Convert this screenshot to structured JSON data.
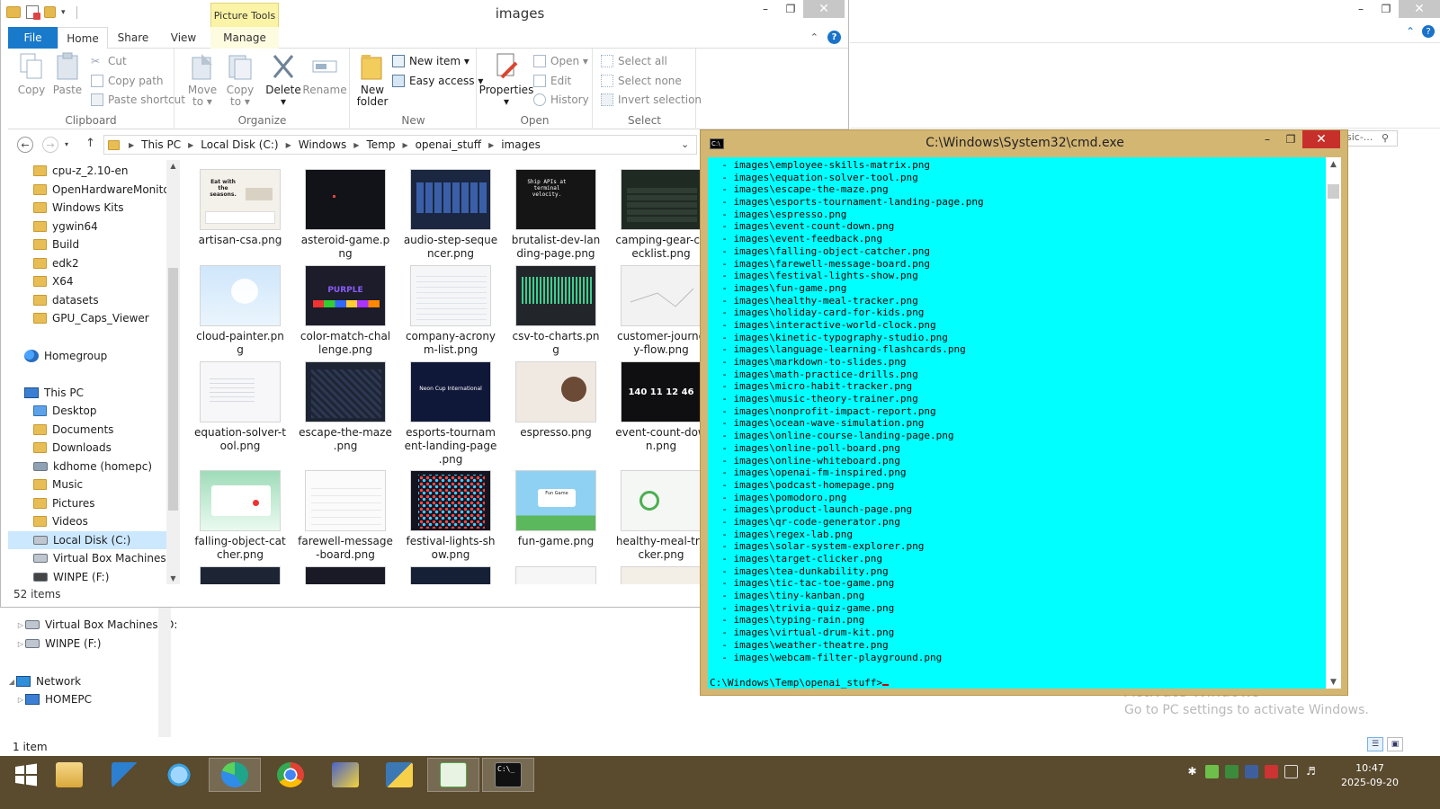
{
  "background_window": {
    "search_placeholder": "sic-...",
    "tree": [
      {
        "label": "Virtual Box Machines (D:",
        "icon": "drive-icon"
      },
      {
        "label": "WINPE (F:)",
        "icon": "drive-icon"
      },
      {
        "label": "Network",
        "icon": "network-icon"
      },
      {
        "label": "HOMEPC",
        "icon": "pc-icon"
      }
    ],
    "status": "1 item",
    "activate_title": "Activate Windows",
    "activate_sub": "Go to PC settings to activate Windows."
  },
  "window": {
    "title": "images",
    "picture_tools": "Picture Tools",
    "tabs": {
      "file": "File",
      "home": "Home",
      "share": "Share",
      "view": "View",
      "manage": "Manage"
    }
  },
  "ribbon": {
    "clipboard": {
      "label": "Clipboard",
      "copy": "Copy",
      "paste": "Paste",
      "cut": "Cut",
      "copy_path": "Copy path",
      "paste_shortcut": "Paste shortcut"
    },
    "organize": {
      "label": "Organize",
      "move_to_1": "Move",
      "move_to_2": "to ▾",
      "copy_to_1": "Copy",
      "copy_to_2": "to ▾",
      "delete": "Delete",
      "delete_arrow": "▾",
      "rename": "Rename"
    },
    "new": {
      "label": "New",
      "new_folder_1": "New",
      "new_folder_2": "folder",
      "new_item": "New item ▾",
      "easy_access": "Easy access ▾"
    },
    "open": {
      "label": "Open",
      "properties": "Properties",
      "properties_arrow": "▾",
      "open": "Open ▾",
      "edit": "Edit",
      "history": "History"
    },
    "select": {
      "label": "Select",
      "select_all": "Select all",
      "select_none": "Select none",
      "invert": "Invert selection"
    }
  },
  "address": {
    "crumbs": [
      "This PC",
      "Local Disk (C:)",
      "Windows",
      "Temp",
      "openai_stuff",
      "images"
    ]
  },
  "nav_pane": {
    "items": [
      {
        "label": "cpu-z_2.10-en",
        "icon": "folder-icon"
      },
      {
        "label": "OpenHardwareMonitor",
        "icon": "folder-icon"
      },
      {
        "label": "Windows Kits",
        "icon": "folder-icon"
      },
      {
        "label": "ygwin64",
        "icon": "folder-icon"
      },
      {
        "label": "Build",
        "icon": "folder-icon"
      },
      {
        "label": "edk2",
        "icon": "folder-icon"
      },
      {
        "label": "X64",
        "icon": "folder-icon"
      },
      {
        "label": "datasets",
        "icon": "folder-icon"
      },
      {
        "label": "GPU_Caps_Viewer",
        "icon": "folder-icon"
      },
      {
        "label": "Homegroup",
        "icon": "homegroup-icon"
      },
      {
        "label": "This PC",
        "icon": "pc-icon"
      },
      {
        "label": "Desktop",
        "icon": "folder-icon"
      },
      {
        "label": "Documents",
        "icon": "folder-icon"
      },
      {
        "label": "Downloads",
        "icon": "folder-icon"
      },
      {
        "label": "kdhome (homepc)",
        "icon": "network-drive-icon"
      },
      {
        "label": "Music",
        "icon": "folder-icon"
      },
      {
        "label": "Pictures",
        "icon": "folder-icon"
      },
      {
        "label": "Videos",
        "icon": "folder-icon"
      },
      {
        "label": "Local Disk (C:)",
        "icon": "drive-icon"
      },
      {
        "label": "Virtual Box Machines (D:",
        "icon": "drive-icon"
      },
      {
        "label": "WINPE (F:)",
        "icon": "drive-icon"
      }
    ]
  },
  "files": [
    {
      "l1": "artisan-csa.png",
      "l2": "",
      "l3": "",
      "theme": "#f4f1ea"
    },
    {
      "l1": "asteroid-game.p",
      "l2": "ng",
      "l3": "",
      "theme": "#111318"
    },
    {
      "l1": "audio-step-seque",
      "l2": "ncer.png",
      "l3": "",
      "theme": "#1b2640"
    },
    {
      "l1": "brutalist-dev-lan",
      "l2": "ding-page.png",
      "l3": "",
      "theme": "#151515"
    },
    {
      "l1": "camping-gear-ch",
      "l2": "ecklist.png",
      "l3": "",
      "theme": "#1f2a22"
    },
    {
      "l1": "cloud-painter.pn",
      "l2": "g",
      "l3": "",
      "theme": "#d8ecfb"
    },
    {
      "l1": "color-match-chal",
      "l2": "lenge.png",
      "l3": "",
      "theme": "#1c1c2a"
    },
    {
      "l1": "company-acrony",
      "l2": "m-list.png",
      "l3": "",
      "theme": "#f5f6f8"
    },
    {
      "l1": "csv-to-charts.pn",
      "l2": "g",
      "l3": "",
      "theme": "#22262b"
    },
    {
      "l1": "customer-journe",
      "l2": "y-flow.png",
      "l3": "",
      "theme": "#f2f2f2"
    },
    {
      "l1": "equation-solver-t",
      "l2": "ool.png",
      "l3": "",
      "theme": "#f7f7f9"
    },
    {
      "l1": "escape-the-maze",
      "l2": ".png",
      "l3": "",
      "theme": "#1d2433"
    },
    {
      "l1": "esports-tournam",
      "l2": "ent-landing-page",
      "l3": ".png",
      "theme": "#10183a"
    },
    {
      "l1": "espresso.png",
      "l2": "",
      "l3": "",
      "theme": "#efe9e2"
    },
    {
      "l1": "event-count-dow",
      "l2": "n.png",
      "l3": "",
      "theme": "#0f0f12"
    },
    {
      "l1": "falling-object-cat",
      "l2": "cher.png",
      "l3": "",
      "theme": "#bfe9d0"
    },
    {
      "l1": "farewell-message",
      "l2": "-board.png",
      "l3": "",
      "theme": "#fbfbfb"
    },
    {
      "l1": "festival-lights-sh",
      "l2": "ow.png",
      "l3": "",
      "theme": "#141420"
    },
    {
      "l1": "fun-game.png",
      "l2": "",
      "l3": "",
      "theme": "#8fd1f2"
    },
    {
      "l1": "healthy-meal-tra",
      "l2": "cker.png",
      "l3": "",
      "theme": "#f5f7f5"
    }
  ],
  "thumb_texts": {
    "artisan": "Eat with the seasons.",
    "brutalist": "Ship APIs at terminal velocity.",
    "color_match": "PURPLE",
    "esports": "Neon Cup International",
    "countdown": "140 11 12 46",
    "fun_game": "Fun Game"
  },
  "status": "52 items",
  "cmd": {
    "title": "C:\\Windows\\System32\\cmd.exe",
    "lines": [
      "  - images\\employee-skills-matrix.png",
      "  - images\\equation-solver-tool.png",
      "  - images\\escape-the-maze.png",
      "  - images\\esports-tournament-landing-page.png",
      "  - images\\espresso.png",
      "  - images\\event-count-down.png",
      "  - images\\event-feedback.png",
      "  - images\\falling-object-catcher.png",
      "  - images\\farewell-message-board.png",
      "  - images\\festival-lights-show.png",
      "  - images\\fun-game.png",
      "  - images\\healthy-meal-tracker.png",
      "  - images\\holiday-card-for-kids.png",
      "  - images\\interactive-world-clock.png",
      "  - images\\kinetic-typography-studio.png",
      "  - images\\language-learning-flashcards.png",
      "  - images\\markdown-to-slides.png",
      "  - images\\math-practice-drills.png",
      "  - images\\micro-habit-tracker.png",
      "  - images\\music-theory-trainer.png",
      "  - images\\nonprofit-impact-report.png",
      "  - images\\ocean-wave-simulation.png",
      "  - images\\online-course-landing-page.png",
      "  - images\\online-poll-board.png",
      "  - images\\online-whiteboard.png",
      "  - images\\openai-fm-inspired.png",
      "  - images\\podcast-homepage.png",
      "  - images\\pomodoro.png",
      "  - images\\product-launch-page.png",
      "  - images\\qr-code-generator.png",
      "  - images\\regex-lab.png",
      "  - images\\solar-system-explorer.png",
      "  - images\\target-clicker.png",
      "  - images\\tea-dunkability.png",
      "  - images\\tic-tac-toe-game.png",
      "  - images\\tiny-kanban.png",
      "  - images\\trivia-quiz-game.png",
      "  - images\\typing-rain.png",
      "  - images\\virtual-drum-kit.png",
      "  - images\\weather-theatre.png",
      "  - images\\webcam-filter-playground.png"
    ],
    "prompt": "C:\\Windows\\Temp\\openai_stuff>"
  },
  "taskbar": {
    "apps": [
      {
        "name": "start-button",
        "color": "#ffffff"
      },
      {
        "name": "file-explorer",
        "color": "#e7c35a"
      },
      {
        "name": "shark-app",
        "color": "#2d7fd0"
      },
      {
        "name": "magnifier-app",
        "color": "#3aa0e0"
      },
      {
        "name": "edge-browser",
        "color": "#1fa58a"
      },
      {
        "name": "chrome-browser",
        "color": "#e34133"
      },
      {
        "name": "network-tool",
        "color": "#4a62c8"
      },
      {
        "name": "python-app",
        "color": "#3c78b3"
      },
      {
        "name": "chart-app",
        "color": "#59a84a"
      },
      {
        "name": "cmd-app",
        "color": "#111111"
      }
    ],
    "time": "10:47",
    "date": "2025-09-20"
  }
}
